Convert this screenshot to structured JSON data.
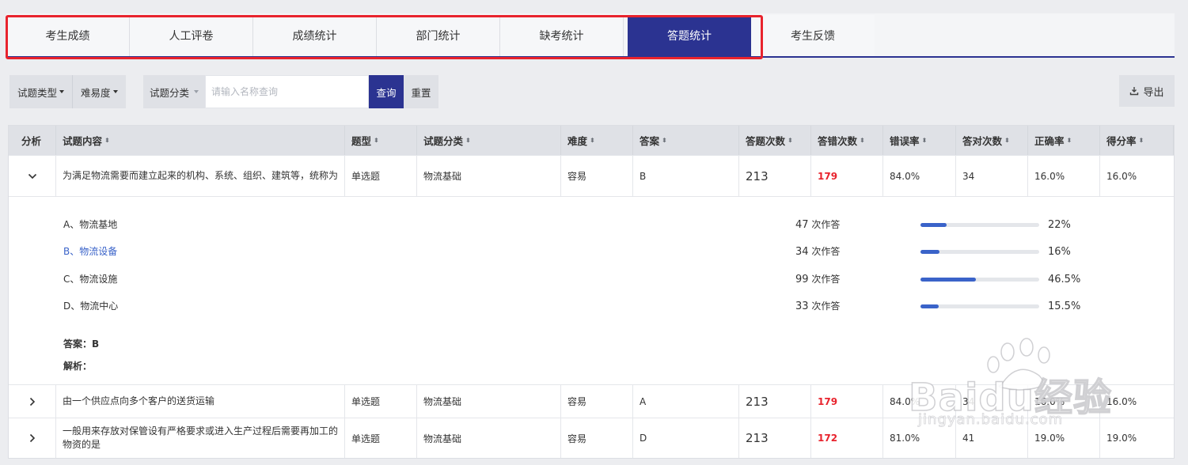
{
  "tabs": [
    {
      "label": "考生成绩"
    },
    {
      "label": "人工评卷"
    },
    {
      "label": "成绩统计"
    },
    {
      "label": "部门统计"
    },
    {
      "label": "缺考统计"
    },
    {
      "label": "答题统计",
      "active": true
    },
    {
      "label": "考生反馈"
    }
  ],
  "filters": {
    "type_label": "试题类型",
    "difficulty_label": "难易度",
    "category_label": "试题分类",
    "search_placeholder": "请输入名称查询",
    "query_label": "查询",
    "reset_label": "重置",
    "export_label": "导出"
  },
  "table": {
    "headers": {
      "analysis": "分析",
      "content": "试题内容",
      "qtype": "题型",
      "category": "试题分类",
      "difficulty": "难度",
      "answer": "答案",
      "attempts": "答题次数",
      "wrong": "答错次数",
      "error_rate": "错误率",
      "right": "答对次数",
      "correct_rate": "正确率",
      "score_rate": "得分率"
    },
    "rows": [
      {
        "content": "为满足物流需要而建立起来的机构、系统、组织、建筑等，统称为",
        "qtype": "单选题",
        "category": "物流基础",
        "difficulty": "容易",
        "answer": "B",
        "attempts": "213",
        "wrong": "179",
        "error_rate": "84.0%",
        "right": "34",
        "correct_rate": "16.0%",
        "score_rate": "16.0%",
        "expanded": true
      },
      {
        "content": "由一个供应点向多个客户的送货运输",
        "qtype": "单选题",
        "category": "物流基础",
        "difficulty": "容易",
        "answer": "A",
        "attempts": "213",
        "wrong": "179",
        "error_rate": "84.0%",
        "right": "34",
        "correct_rate": "16.0%",
        "score_rate": "16.0%",
        "expanded": false
      },
      {
        "content": "一般用来存放对保管设有严格要求或进入生产过程后需要再加工的物资的是",
        "qtype": "单选题",
        "category": "物流基础",
        "difficulty": "容易",
        "answer": "D",
        "attempts": "213",
        "wrong": "172",
        "error_rate": "81.0%",
        "right": "41",
        "correct_rate": "19.0%",
        "score_rate": "19.0%",
        "expanded": false
      }
    ]
  },
  "detail": {
    "options": [
      {
        "label": "A、物流基地",
        "count": "47",
        "unit": "次作答",
        "percent": "22%",
        "fraction": 0.22,
        "selected": false
      },
      {
        "label": "B、物流设备",
        "count": "34",
        "unit": "次作答",
        "percent": "16%",
        "fraction": 0.16,
        "selected": true
      },
      {
        "label": "C、物流设施",
        "count": "99",
        "unit": "次作答",
        "percent": "46.5%",
        "fraction": 0.465,
        "selected": false
      },
      {
        "label": "D、物流中心",
        "count": "33",
        "unit": "次作答",
        "percent": "15.5%",
        "fraction": 0.155,
        "selected": false
      }
    ],
    "answer_text": "答案：B",
    "analysis_text": "解析："
  },
  "watermark": {
    "text": "Baidu经验",
    "url": "jingyan.baidu.com"
  },
  "colors": {
    "primary": "#2b3391",
    "highlight_border": "#e8232d",
    "error_red": "#e8232d",
    "bar_blue": "#3a63c9"
  }
}
